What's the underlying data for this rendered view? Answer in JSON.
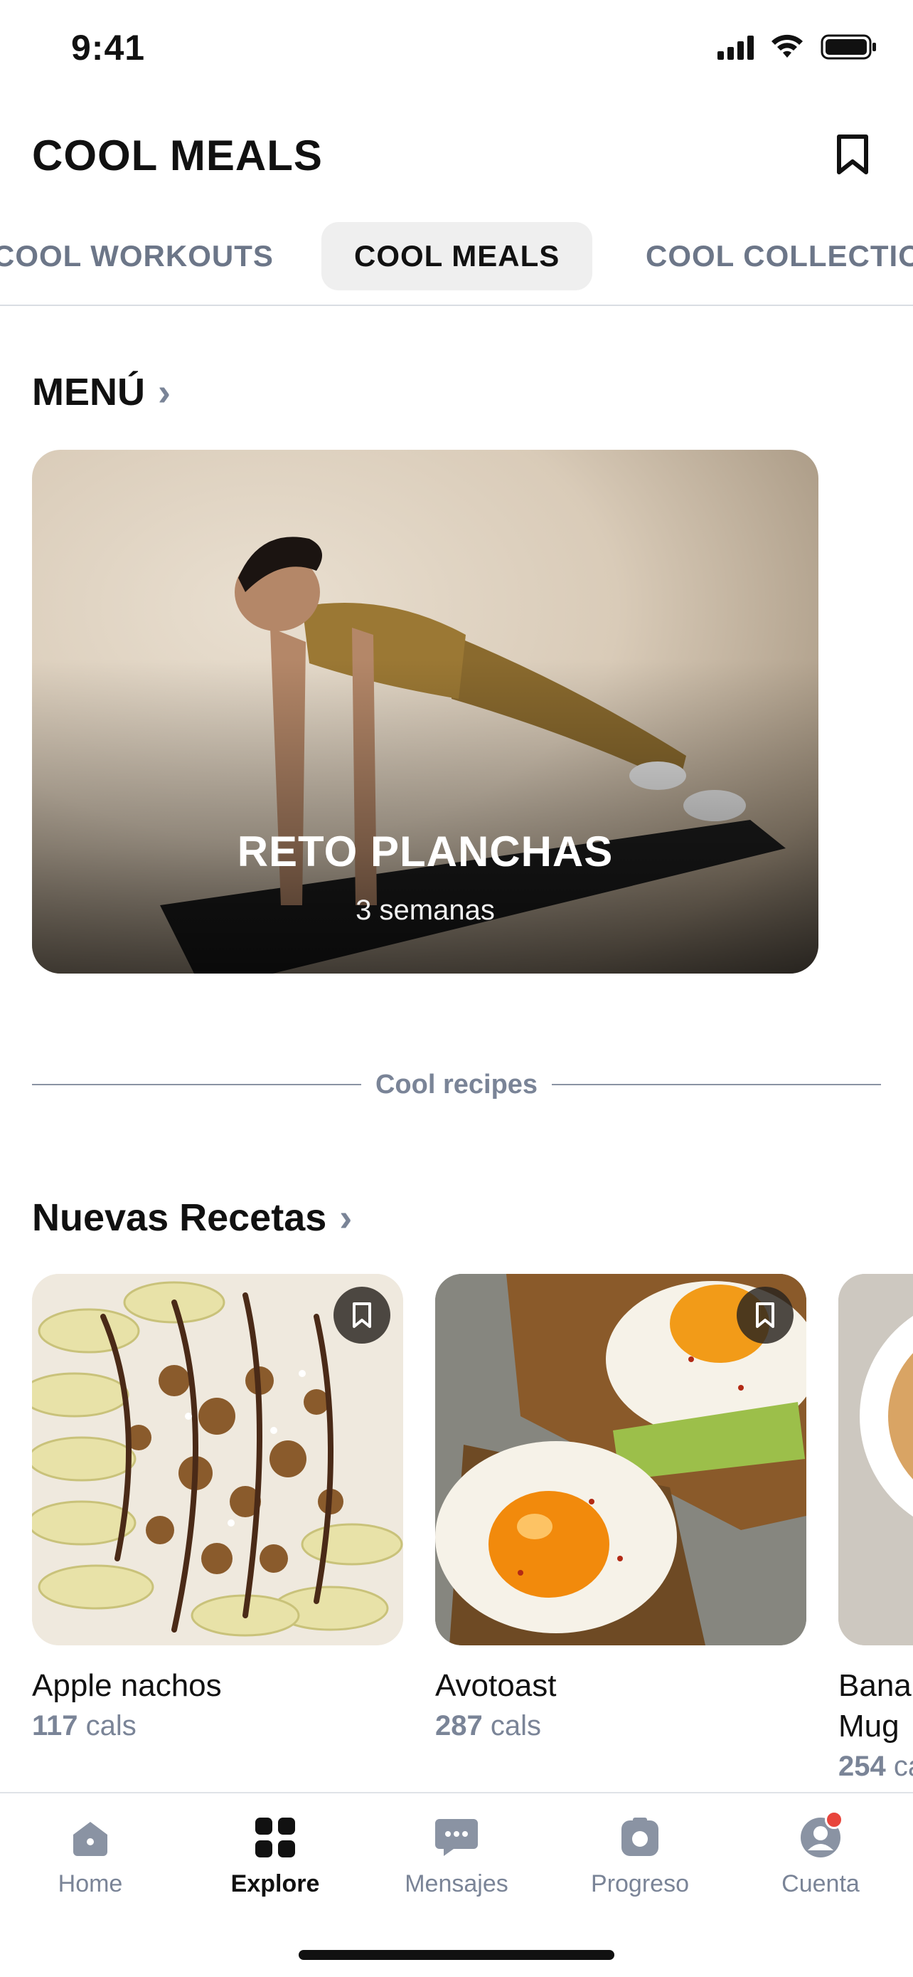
{
  "status": {
    "time": "9:41"
  },
  "header": {
    "title": "COOL MEALS"
  },
  "tabs": [
    {
      "label": "COOL WORKOUTS",
      "active": false
    },
    {
      "label": "COOL MEALS",
      "active": true
    },
    {
      "label": "COOL COLLECTIONS",
      "active": false
    }
  ],
  "menu": {
    "title": "MENÚ",
    "card": {
      "title": "RETO PLANCHAS",
      "subtitle": "3 semanas"
    }
  },
  "divider": {
    "label": "Cool recipes"
  },
  "new_recipes": {
    "title": "Nuevas Recetas",
    "items": [
      {
        "name": "Apple nachos",
        "cals_value": "117",
        "cals_unit": "cals"
      },
      {
        "name": "Avotoast",
        "cals_value": "287",
        "cals_unit": "cals"
      },
      {
        "name": "Banana Mug",
        "cals_value": "254",
        "cals_unit": "cals"
      }
    ]
  },
  "nav": [
    {
      "label": "Home",
      "icon": "home-icon",
      "active": false
    },
    {
      "label": "Explore",
      "icon": "grid-icon",
      "active": true
    },
    {
      "label": "Mensajes",
      "icon": "chat-icon",
      "active": false
    },
    {
      "label": "Progreso",
      "icon": "progress-icon",
      "active": false
    },
    {
      "label": "Cuenta",
      "icon": "account-icon",
      "active": false,
      "badge": true
    }
  ],
  "colors": {
    "accent_muted": "#7a8497",
    "notification": "#e8453c"
  }
}
